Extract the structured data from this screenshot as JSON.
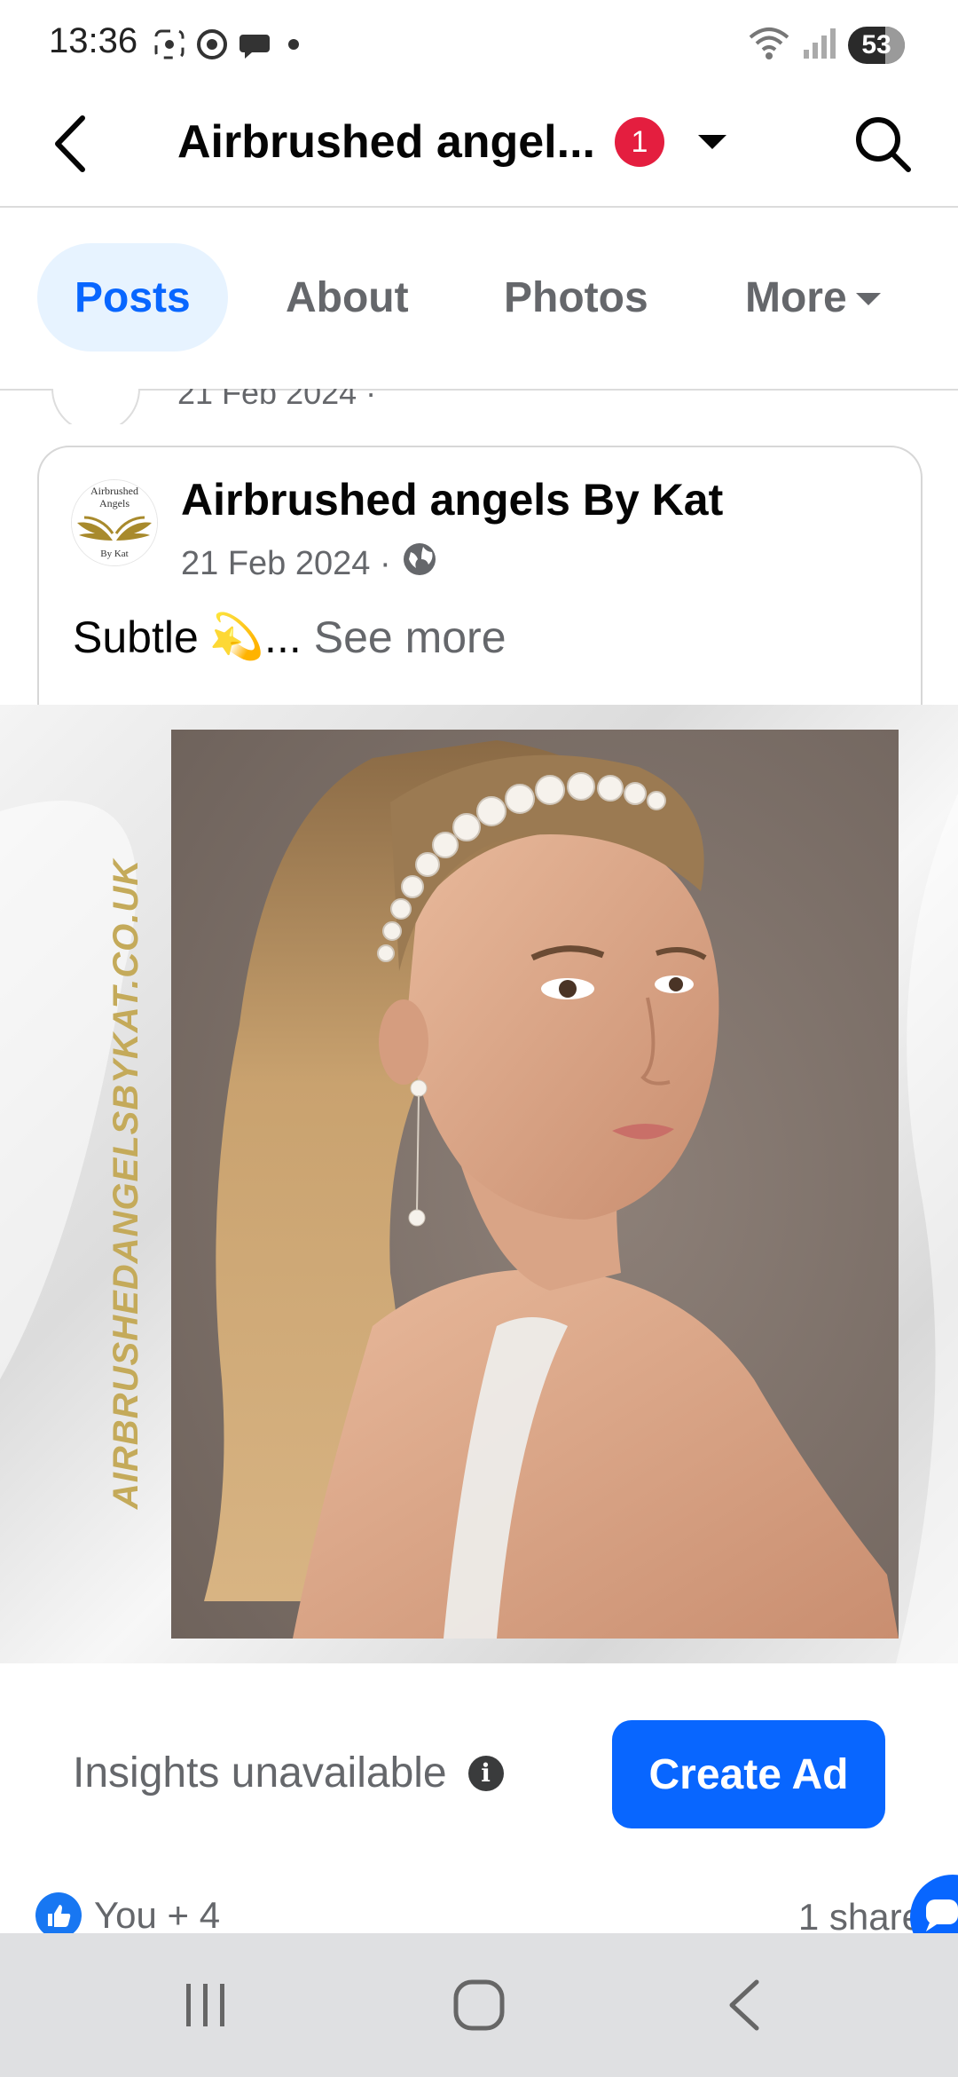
{
  "status_bar": {
    "time": "13:36",
    "battery": "53",
    "wifi_label": "6"
  },
  "header": {
    "title": "Airbrushed angel...",
    "notification_count": "1"
  },
  "tabs": [
    {
      "label": "Posts",
      "active": true
    },
    {
      "label": "About",
      "active": false
    },
    {
      "label": "Photos",
      "active": false
    },
    {
      "label": "More",
      "active": false
    }
  ],
  "prev_post": {
    "date": "21 Feb 2024 ·"
  },
  "post": {
    "author": "Airbrushed angels By Kat",
    "date": "21 Feb 2024 ·",
    "text": "Subtle",
    "emoji": "💫",
    "ellipsis": "...",
    "see_more": "See more",
    "avatar_text_top": "Airbrushed",
    "avatar_text_mid": "Angels",
    "avatar_text_bottom": "By Kat",
    "image_watermark": "AIRBRUSHEDANGELSBYKAT.CO.UK"
  },
  "insights": {
    "text": "Insights unavailable",
    "create_ad": "Create Ad"
  },
  "reactions": {
    "summary": "You + 4",
    "shares": "1 share"
  },
  "colors": {
    "accent": "#0866ff",
    "badge": "#e41e3f",
    "tab_active_bg": "#e7f3ff",
    "gold": "#a88a2c"
  }
}
